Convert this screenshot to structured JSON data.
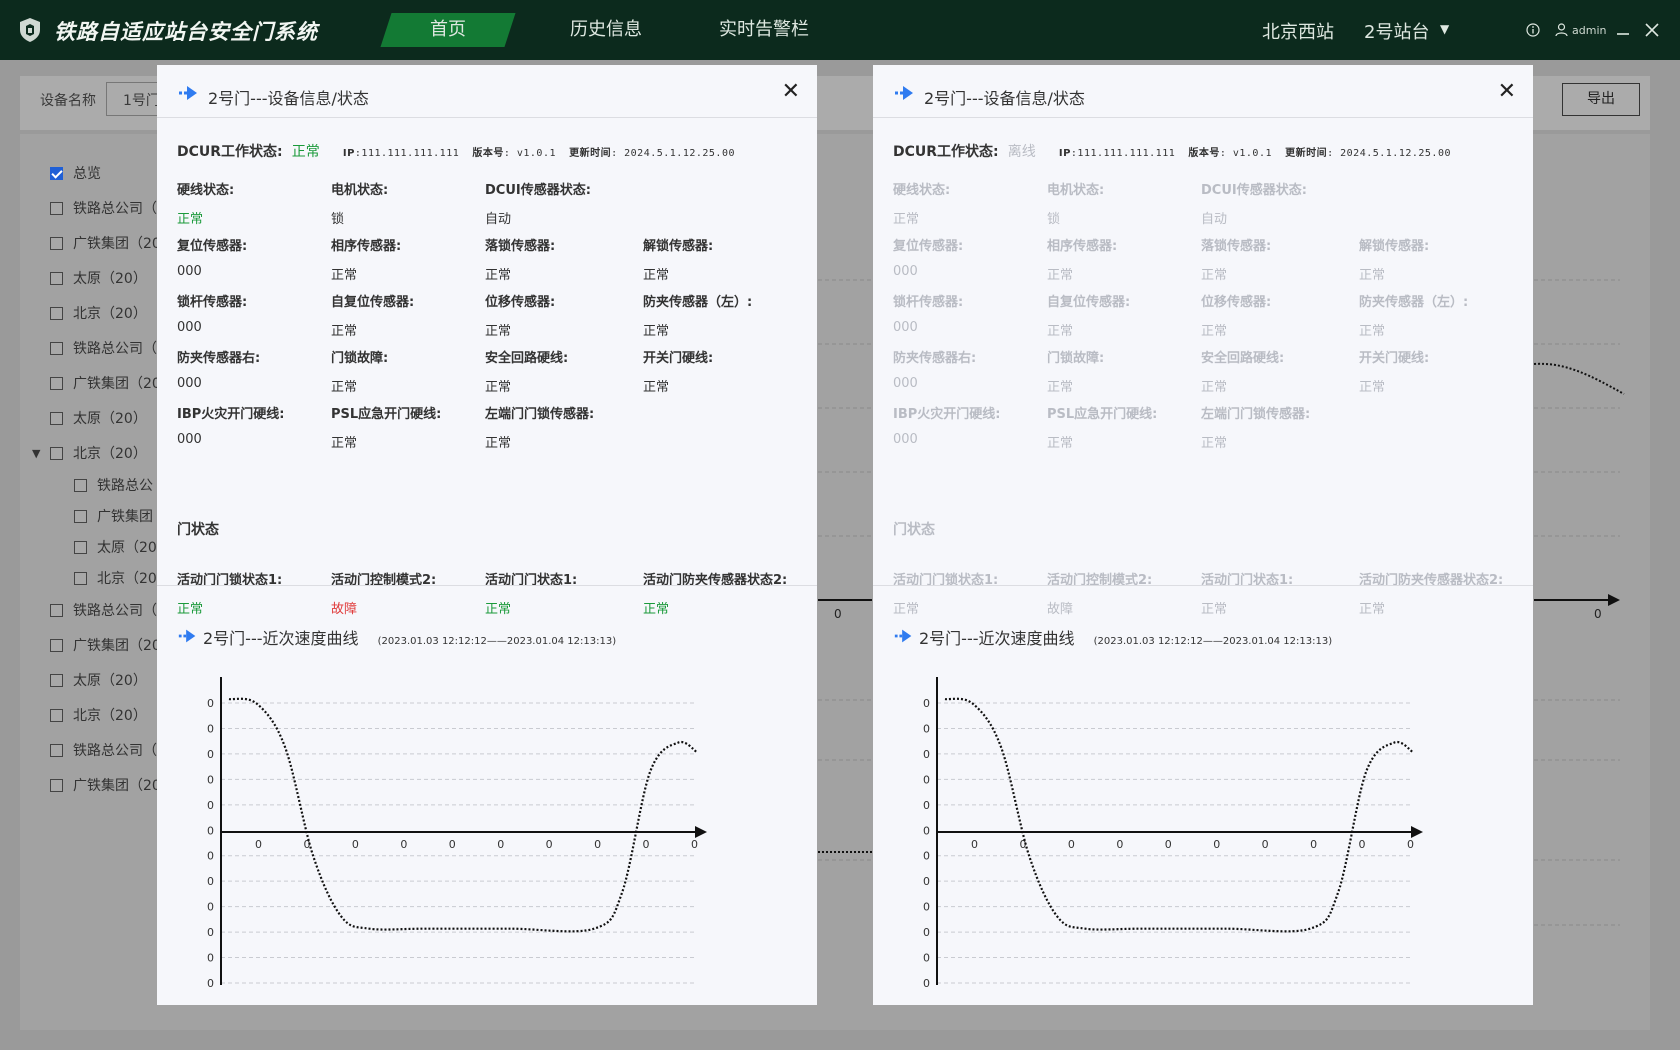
{
  "app": {
    "title": "铁路自适应站台安全门系统",
    "nav": [
      "首页",
      "历史信息",
      "实时告警栏"
    ],
    "active_nav": 0,
    "station": "北京西站",
    "platform": "2号站台",
    "user": "admin",
    "accent": "#137a34"
  },
  "background": {
    "filter_label": "设备名称",
    "filter_value": "1号门",
    "export_button": "导出",
    "tree": [
      {
        "label": "总览",
        "checked": true
      },
      {
        "label": "铁路总公司（"
      },
      {
        "label": "广铁集团（20"
      },
      {
        "label": "太原（20）"
      },
      {
        "label": "北京（20）"
      },
      {
        "label": "铁路总公司（"
      },
      {
        "label": "广铁集团（20"
      },
      {
        "label": "太原（20）"
      },
      {
        "label": "北京（20）",
        "expanded": true
      },
      {
        "label": "铁路总公",
        "child": true
      },
      {
        "label": "广铁集团",
        "child": true
      },
      {
        "label": "太原（20",
        "child": true
      },
      {
        "label": "北京（20",
        "child": true
      },
      {
        "label": "铁路总公司（"
      },
      {
        "label": "广铁集团（20"
      },
      {
        "label": "太原（20）"
      },
      {
        "label": "北京（20）"
      },
      {
        "label": "铁路总公司（"
      },
      {
        "label": "广铁集团（20"
      }
    ],
    "axis_tick": "0"
  },
  "dialogs": [
    {
      "state": "online",
      "title": "2号门---设备信息/状态",
      "dcur_label": "DCUR工作状态:",
      "dcur_status": "正常",
      "ip_label": "IP",
      "ip": ":111.111.111.111",
      "version_label": "版本号",
      "version": ": v1.0.1",
      "update_label": "更新时间",
      "update": ": 2024.5.1.12.25.00",
      "fields": [
        {
          "k": "硬线状态:",
          "v": "正常",
          "tone": "green"
        },
        {
          "k": "电机状态:",
          "v": "锁"
        },
        {
          "k": "DCUI传感器状态:",
          "v": "自动"
        },
        {
          "k": "复位传感器:",
          "v": "000"
        },
        {
          "k": "相序传感器:",
          "v": "正常"
        },
        {
          "k": "落锁传感器:",
          "v": "正常"
        },
        {
          "k": "解锁传感器:",
          "v": "正常"
        },
        {
          "k": "锁杆传感器:",
          "v": "000"
        },
        {
          "k": "自复位传感器:",
          "v": "正常"
        },
        {
          "k": "位移传感器:",
          "v": "正常"
        },
        {
          "k": "防夹传感器（左）:",
          "v": "正常"
        },
        {
          "k": "防夹传感器右:",
          "v": "000"
        },
        {
          "k": "门锁故障:",
          "v": "正常"
        },
        {
          "k": "安全回路硬线:",
          "v": "正常"
        },
        {
          "k": "开关门硬线:",
          "v": "正常"
        },
        {
          "k": "IBP火灾开门硬线:",
          "v": "000"
        },
        {
          "k": "PSL应急开门硬线:",
          "v": "正常"
        },
        {
          "k": "左端门门锁传感器:",
          "v": "正常"
        }
      ],
      "door_section": "门状态",
      "door_fields": [
        {
          "k": "活动门门锁状态1:",
          "v": "正常",
          "tone": "green"
        },
        {
          "k": "活动门控制模式2:",
          "v": "故障",
          "tone": "red"
        },
        {
          "k": "活动门门状态1:",
          "v": "正常",
          "tone": "green"
        },
        {
          "k": "活动门防夹传感器状态2:",
          "v": "正常",
          "tone": "green"
        }
      ],
      "curve_title": "2号门---近次速度曲线",
      "curve_range": "(2023.01.03  12:12:12——2023.01.04  12:13:13)"
    },
    {
      "state": "offline",
      "title": "2号门---设备信息/状态",
      "dcur_label": "DCUR工作状态:",
      "dcur_status": "离线",
      "ip_label": "IP",
      "ip": ":111.111.111.111",
      "version_label": "版本号",
      "version": ": v1.0.1",
      "update_label": "更新时间",
      "update": ": 2024.5.1.12.25.00",
      "fields": [
        {
          "k": "硬线状态:",
          "v": "正常"
        },
        {
          "k": "电机状态:",
          "v": "锁"
        },
        {
          "k": "DCUI传感器状态:",
          "v": "自动"
        },
        {
          "k": "复位传感器:",
          "v": "000"
        },
        {
          "k": "相序传感器:",
          "v": "正常"
        },
        {
          "k": "落锁传感器:",
          "v": "正常"
        },
        {
          "k": "解锁传感器:",
          "v": "正常"
        },
        {
          "k": "锁杆传感器:",
          "v": "000"
        },
        {
          "k": "自复位传感器:",
          "v": "正常"
        },
        {
          "k": "位移传感器:",
          "v": "正常"
        },
        {
          "k": "防夹传感器（左）:",
          "v": "正常"
        },
        {
          "k": "防夹传感器右:",
          "v": "000"
        },
        {
          "k": "门锁故障:",
          "v": "正常"
        },
        {
          "k": "安全回路硬线:",
          "v": "正常"
        },
        {
          "k": "开关门硬线:",
          "v": "正常"
        },
        {
          "k": "IBP火灾开门硬线:",
          "v": "000"
        },
        {
          "k": "PSL应急开门硬线:",
          "v": "正常"
        },
        {
          "k": "左端门门锁传感器:",
          "v": "正常"
        }
      ],
      "door_section": "门状态",
      "door_fields": [
        {
          "k": "活动门门锁状态1:",
          "v": "正常"
        },
        {
          "k": "活动门控制模式2:",
          "v": "故障"
        },
        {
          "k": "活动门门状态1:",
          "v": "正常"
        },
        {
          "k": "活动门防夹传感器状态2:",
          "v": "正常"
        }
      ],
      "curve_title": "2号门---近次速度曲线",
      "curve_range": "(2023.01.03  12:12:12——2023.01.04  12:13:13)"
    }
  ],
  "chart_data": {
    "type": "line",
    "title": "2号门---近次速度曲线",
    "y_tick_labels": [
      "0",
      "0",
      "0",
      "0",
      "0",
      "0",
      "0",
      "0",
      "0",
      "0",
      "0",
      "0"
    ],
    "x_tick_labels": [
      "0",
      "0",
      "0",
      "0",
      "0",
      "0",
      "0",
      "0",
      "0",
      "0"
    ],
    "series": [
      {
        "style": "dotted",
        "x": [
          0,
          0.06,
          0.12,
          0.18,
          0.24,
          0.3,
          0.42,
          0.6,
          0.78,
          0.84,
          0.9,
          0.96,
          1.0
        ],
        "y": [
          5.5,
          5.3,
          3.5,
          -1.0,
          -3.5,
          -4.0,
          -4.0,
          -4.0,
          -4.0,
          -2.5,
          2.5,
          3.7,
          3.3
        ]
      }
    ],
    "grid": true,
    "ylim": [
      -6,
      6
    ]
  }
}
